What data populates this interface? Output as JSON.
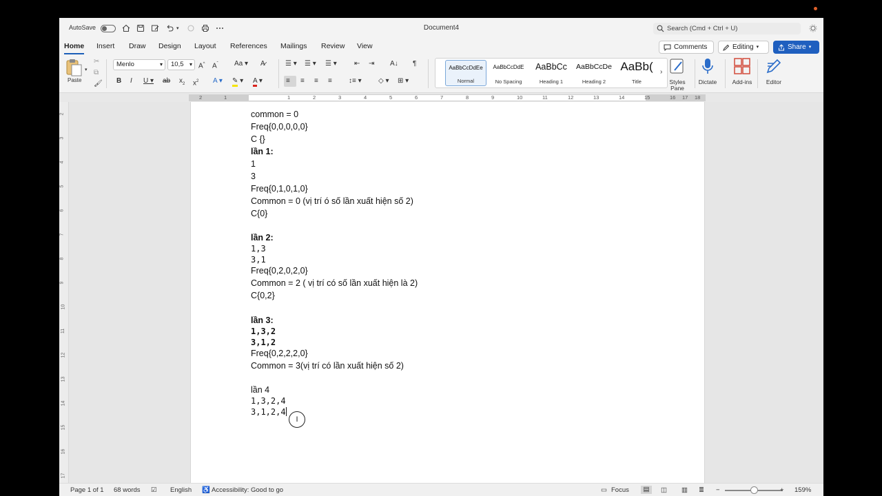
{
  "titlebar": {
    "autosave_label": "AutoSave",
    "doc_title": "Document4",
    "search_placeholder": "Search (Cmd + Ctrl + U)"
  },
  "tabs": [
    "Home",
    "Insert",
    "Draw",
    "Design",
    "Layout",
    "References",
    "Mailings",
    "Review",
    "View"
  ],
  "header_buttons": {
    "comments": "Comments",
    "editing": "Editing",
    "share": "Share"
  },
  "ribbon": {
    "paste_label": "Paste",
    "font_name": "Menlo",
    "font_size": "10,5",
    "styles": [
      {
        "preview": "AaBbCcDdEe",
        "name": "Normal"
      },
      {
        "preview": "AaBbCcDdE",
        "name": "No Spacing"
      },
      {
        "preview": "AaBbCc",
        "name": "Heading 1"
      },
      {
        "preview": "AaBbCcDe",
        "name": "Heading 2"
      },
      {
        "preview": "AaBb(",
        "name": "Title"
      }
    ],
    "styles_pane": "Styles Pane",
    "dictate": "Dictate",
    "addins": "Add-ins",
    "editor": "Editor"
  },
  "ruler_numbers": [
    "2",
    "1",
    "1",
    "2",
    "3",
    "4",
    "5",
    "6",
    "7",
    "8",
    "9",
    "10",
    "11",
    "12",
    "13",
    "14",
    "15",
    "16",
    "17",
    "18"
  ],
  "vruler_numbers": [
    "2",
    "3",
    "4",
    "5",
    "6",
    "7",
    "8",
    "9",
    "10",
    "11",
    "12",
    "13",
    "14",
    "15",
    "16",
    "17"
  ],
  "document": {
    "lines": [
      {
        "text": "common = 0",
        "style": ""
      },
      {
        "text": "Freq{0,0,0,0,0}",
        "style": ""
      },
      {
        "text": "C {}",
        "style": ""
      },
      {
        "text": "lần 1:",
        "style": "b"
      },
      {
        "text": "1",
        "style": ""
      },
      {
        "text": "3",
        "style": ""
      },
      {
        "text": "Freq{0,1,0,1,0}",
        "style": ""
      },
      {
        "text": "Common = 0 (vị trí ó số lần xuất hiện số 2)",
        "style": ""
      },
      {
        "text": "C{0}",
        "style": ""
      },
      {
        "text": "lần 2:",
        "style": "b"
      },
      {
        "text": "1,3",
        "style": "mono b1"
      },
      {
        "text": "3,1",
        "style": "mono b1"
      },
      {
        "text": "Freq{0,2,0,2,0}",
        "style": ""
      },
      {
        "text": "Common = 2 ( vị trí có số lần xuất hiện là 2)",
        "style": ""
      },
      {
        "text": "C{0,2}",
        "style": ""
      },
      {
        "text": "lần 3:",
        "style": "b"
      },
      {
        "text": "1,3,2",
        "style": "mono b"
      },
      {
        "text": "3,1,2",
        "style": "mono b"
      },
      {
        "text": "Freq{0,2,2,2,0}",
        "style": ""
      },
      {
        "text": "Common = 3(vị trí có lần xuất hiện số 2)",
        "style": ""
      },
      {
        "text": "lần 4",
        "style": ""
      },
      {
        "text": "1,3,2,4",
        "style": "mono"
      },
      {
        "text": "3,1,2,4",
        "style": "mono"
      }
    ]
  },
  "status": {
    "page": "Page 1 of 1",
    "words": "68 words",
    "language": "English",
    "accessibility": "Accessibility: Good to go",
    "focus": "Focus",
    "zoom": "159%"
  }
}
